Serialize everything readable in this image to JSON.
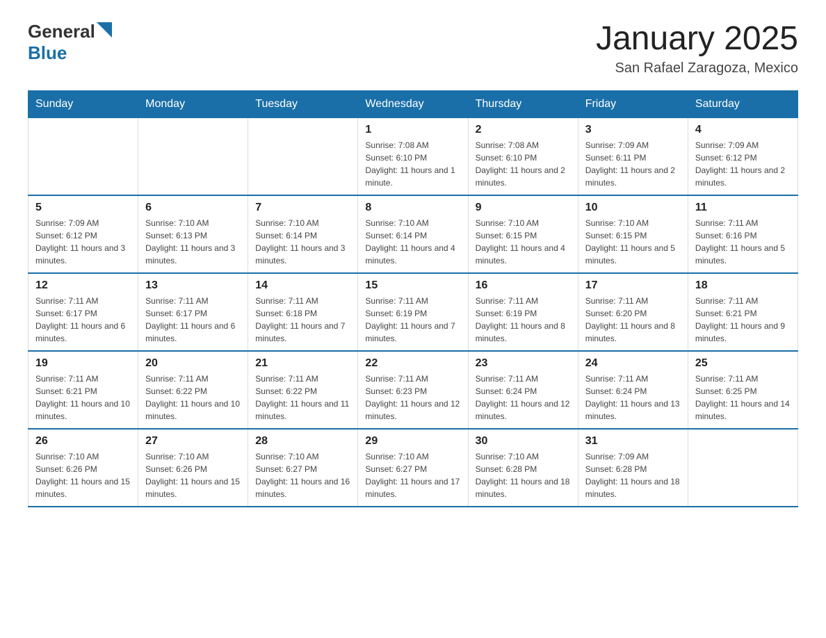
{
  "header": {
    "logo_general": "General",
    "logo_blue": "Blue",
    "title": "January 2025",
    "subtitle": "San Rafael Zaragoza, Mexico"
  },
  "days_of_week": [
    "Sunday",
    "Monday",
    "Tuesday",
    "Wednesday",
    "Thursday",
    "Friday",
    "Saturday"
  ],
  "weeks": [
    [
      {
        "day": "",
        "info": ""
      },
      {
        "day": "",
        "info": ""
      },
      {
        "day": "",
        "info": ""
      },
      {
        "day": "1",
        "info": "Sunrise: 7:08 AM\nSunset: 6:10 PM\nDaylight: 11 hours and 1 minute."
      },
      {
        "day": "2",
        "info": "Sunrise: 7:08 AM\nSunset: 6:10 PM\nDaylight: 11 hours and 2 minutes."
      },
      {
        "day": "3",
        "info": "Sunrise: 7:09 AM\nSunset: 6:11 PM\nDaylight: 11 hours and 2 minutes."
      },
      {
        "day": "4",
        "info": "Sunrise: 7:09 AM\nSunset: 6:12 PM\nDaylight: 11 hours and 2 minutes."
      }
    ],
    [
      {
        "day": "5",
        "info": "Sunrise: 7:09 AM\nSunset: 6:12 PM\nDaylight: 11 hours and 3 minutes."
      },
      {
        "day": "6",
        "info": "Sunrise: 7:10 AM\nSunset: 6:13 PM\nDaylight: 11 hours and 3 minutes."
      },
      {
        "day": "7",
        "info": "Sunrise: 7:10 AM\nSunset: 6:14 PM\nDaylight: 11 hours and 3 minutes."
      },
      {
        "day": "8",
        "info": "Sunrise: 7:10 AM\nSunset: 6:14 PM\nDaylight: 11 hours and 4 minutes."
      },
      {
        "day": "9",
        "info": "Sunrise: 7:10 AM\nSunset: 6:15 PM\nDaylight: 11 hours and 4 minutes."
      },
      {
        "day": "10",
        "info": "Sunrise: 7:10 AM\nSunset: 6:15 PM\nDaylight: 11 hours and 5 minutes."
      },
      {
        "day": "11",
        "info": "Sunrise: 7:11 AM\nSunset: 6:16 PM\nDaylight: 11 hours and 5 minutes."
      }
    ],
    [
      {
        "day": "12",
        "info": "Sunrise: 7:11 AM\nSunset: 6:17 PM\nDaylight: 11 hours and 6 minutes."
      },
      {
        "day": "13",
        "info": "Sunrise: 7:11 AM\nSunset: 6:17 PM\nDaylight: 11 hours and 6 minutes."
      },
      {
        "day": "14",
        "info": "Sunrise: 7:11 AM\nSunset: 6:18 PM\nDaylight: 11 hours and 7 minutes."
      },
      {
        "day": "15",
        "info": "Sunrise: 7:11 AM\nSunset: 6:19 PM\nDaylight: 11 hours and 7 minutes."
      },
      {
        "day": "16",
        "info": "Sunrise: 7:11 AM\nSunset: 6:19 PM\nDaylight: 11 hours and 8 minutes."
      },
      {
        "day": "17",
        "info": "Sunrise: 7:11 AM\nSunset: 6:20 PM\nDaylight: 11 hours and 8 minutes."
      },
      {
        "day": "18",
        "info": "Sunrise: 7:11 AM\nSunset: 6:21 PM\nDaylight: 11 hours and 9 minutes."
      }
    ],
    [
      {
        "day": "19",
        "info": "Sunrise: 7:11 AM\nSunset: 6:21 PM\nDaylight: 11 hours and 10 minutes."
      },
      {
        "day": "20",
        "info": "Sunrise: 7:11 AM\nSunset: 6:22 PM\nDaylight: 11 hours and 10 minutes."
      },
      {
        "day": "21",
        "info": "Sunrise: 7:11 AM\nSunset: 6:22 PM\nDaylight: 11 hours and 11 minutes."
      },
      {
        "day": "22",
        "info": "Sunrise: 7:11 AM\nSunset: 6:23 PM\nDaylight: 11 hours and 12 minutes."
      },
      {
        "day": "23",
        "info": "Sunrise: 7:11 AM\nSunset: 6:24 PM\nDaylight: 11 hours and 12 minutes."
      },
      {
        "day": "24",
        "info": "Sunrise: 7:11 AM\nSunset: 6:24 PM\nDaylight: 11 hours and 13 minutes."
      },
      {
        "day": "25",
        "info": "Sunrise: 7:11 AM\nSunset: 6:25 PM\nDaylight: 11 hours and 14 minutes."
      }
    ],
    [
      {
        "day": "26",
        "info": "Sunrise: 7:10 AM\nSunset: 6:26 PM\nDaylight: 11 hours and 15 minutes."
      },
      {
        "day": "27",
        "info": "Sunrise: 7:10 AM\nSunset: 6:26 PM\nDaylight: 11 hours and 15 minutes."
      },
      {
        "day": "28",
        "info": "Sunrise: 7:10 AM\nSunset: 6:27 PM\nDaylight: 11 hours and 16 minutes."
      },
      {
        "day": "29",
        "info": "Sunrise: 7:10 AM\nSunset: 6:27 PM\nDaylight: 11 hours and 17 minutes."
      },
      {
        "day": "30",
        "info": "Sunrise: 7:10 AM\nSunset: 6:28 PM\nDaylight: 11 hours and 18 minutes."
      },
      {
        "day": "31",
        "info": "Sunrise: 7:09 AM\nSunset: 6:28 PM\nDaylight: 11 hours and 18 minutes."
      },
      {
        "day": "",
        "info": ""
      }
    ]
  ]
}
